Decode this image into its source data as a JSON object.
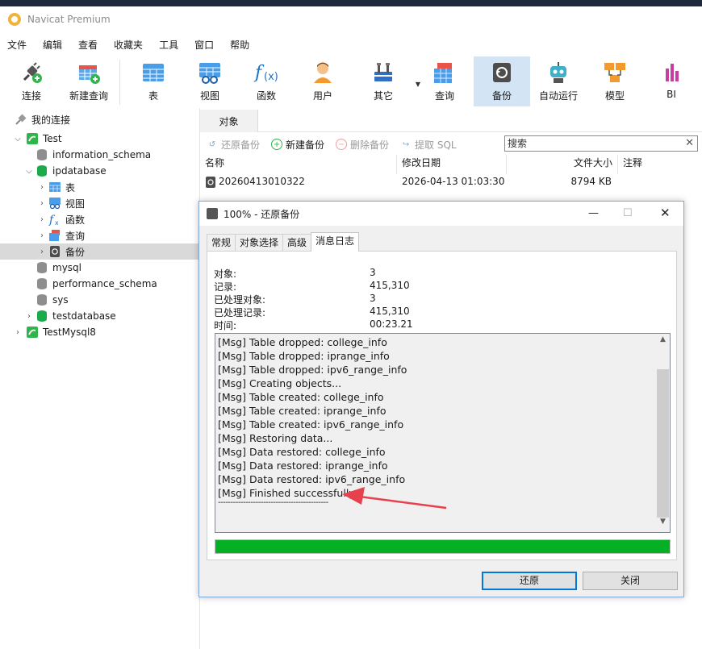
{
  "app": {
    "title": "Navicat Premium"
  },
  "menu": [
    "文件",
    "编辑",
    "查看",
    "收藏夹",
    "工具",
    "窗口",
    "帮助"
  ],
  "toolbar": {
    "connect": "连接",
    "new_query": "新建查询",
    "table": "表",
    "view": "视图",
    "function": "函数",
    "user": "用户",
    "other": "其它",
    "query": "查询",
    "backup": "备份",
    "automation": "自动运行",
    "model": "模型",
    "bi": "BI"
  },
  "sidebar": {
    "header": "我的连接",
    "items": [
      {
        "label": "Test"
      },
      {
        "label": "information_schema"
      },
      {
        "label": "ipdatabase"
      },
      {
        "label": "表"
      },
      {
        "label": "视图"
      },
      {
        "label": "函数"
      },
      {
        "label": "查询"
      },
      {
        "label": "备份"
      },
      {
        "label": "mysql"
      },
      {
        "label": "performance_schema"
      },
      {
        "label": "sys"
      },
      {
        "label": "testdatabase"
      },
      {
        "label": "TestMysql8"
      }
    ]
  },
  "objects": {
    "tab": "对象",
    "actions": {
      "restore": "还原备份",
      "new_backup": "新建备份",
      "delete_backup": "删除备份",
      "extract_sql": "提取 SQL"
    },
    "search_placeholder": "搜索",
    "columns": {
      "name": "名称",
      "modified": "修改日期",
      "size": "文件大小",
      "comment": "注释"
    },
    "rows": [
      {
        "name": "20260413010322",
        "modified": "2026-04-13 01:03:30",
        "size": "8794 KB",
        "comment": ""
      }
    ]
  },
  "dialog": {
    "title": "100% - 还原备份",
    "tabs": [
      "常规",
      "对象选择",
      "高级",
      "消息日志"
    ],
    "active_tab": "消息日志",
    "stats": [
      {
        "label": "对象:",
        "value": "3"
      },
      {
        "label": "记录:",
        "value": "415,310"
      },
      {
        "label": "已处理对象:",
        "value": "3"
      },
      {
        "label": "已处理记录:",
        "value": "415,310"
      },
      {
        "label": "时间:",
        "value": "00:23.21"
      }
    ],
    "log": [
      "[Msg] Table dropped: college_info",
      "[Msg] Table dropped: iprange_info",
      "[Msg] Table dropped: ipv6_range_info",
      "[Msg] Creating objects...",
      "[Msg] Table created: college_info",
      "[Msg] Table created: iprange_info",
      "[Msg] Table created: ipv6_range_info",
      "[Msg] Restoring data...",
      "[Msg] Data restored: college_info",
      "[Msg] Data restored: iprange_info",
      "[Msg] Data restored: ipv6_range_info",
      "[Msg] Finished successfully",
      "--------------------------------------------"
    ],
    "progress": 1.0,
    "buttons": {
      "restore": "还原",
      "close": "关闭"
    }
  },
  "colors": {
    "progress_fill": "#06b025",
    "annotation_arrow": "#e8414d",
    "selection": "#d3e4f5",
    "db_active": "#1bab4b"
  }
}
